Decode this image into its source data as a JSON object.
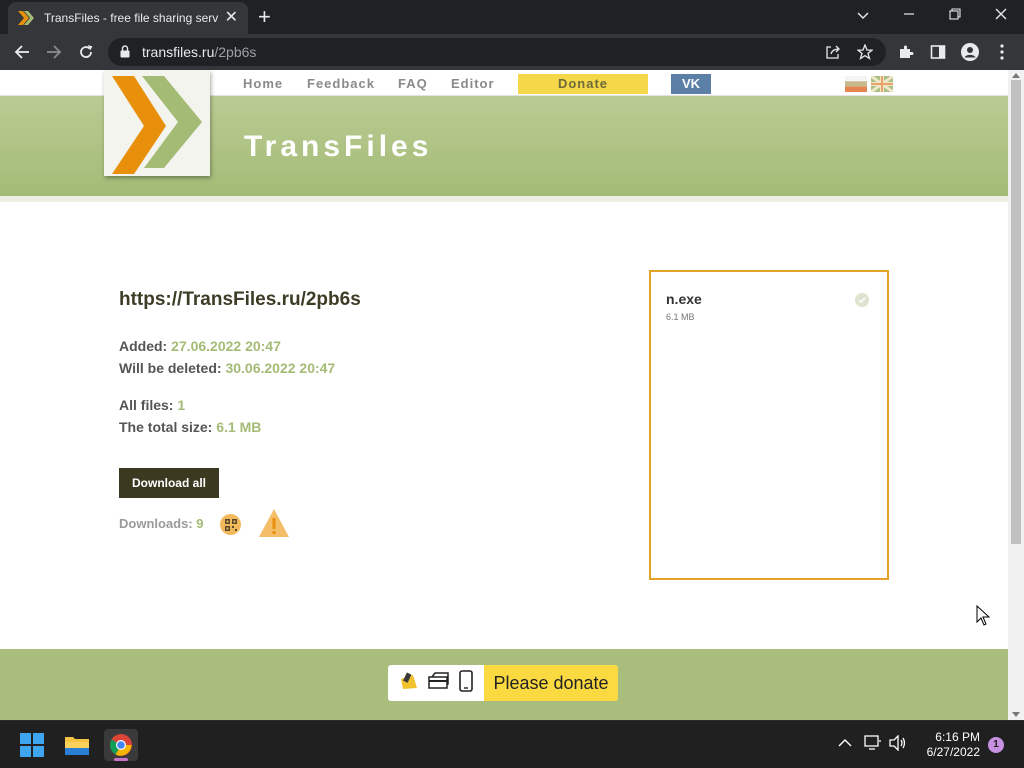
{
  "browser": {
    "tab_title": "TransFiles - free file sharing servic",
    "url_host": "transfiles.ru",
    "url_path": "/2pb6s"
  },
  "nav": {
    "items": [
      "Home",
      "Feedback",
      "FAQ",
      "Editor"
    ],
    "donate_label": "Donate",
    "vk_label": "VK"
  },
  "site": {
    "name": "TransFiles"
  },
  "share": {
    "url": "https://TransFiles.ru/2pb6s",
    "added_label": "Added:",
    "added_value": "27.06.2022 20:47",
    "deleted_label": "Will be deleted:",
    "deleted_value": "30.06.2022 20:47",
    "files_label": "All files:",
    "files_value": "1",
    "size_label": "The total size:",
    "size_value": "6.1 MB",
    "download_all_label": "Download all",
    "downloads_label": "Downloads:",
    "downloads_value": "9"
  },
  "files": [
    {
      "name": "n.exe",
      "size": "6.1 MB"
    }
  ],
  "footer": {
    "donate_label": "Please donate"
  },
  "taskbar": {
    "time": "6:16 PM",
    "date": "6/27/2022",
    "notifications": "1"
  },
  "colors": {
    "brand_green": "#a4bb76",
    "brand_orange": "#e8900c",
    "donate_yellow": "#f7d74a",
    "panel_border": "#e3a227"
  }
}
